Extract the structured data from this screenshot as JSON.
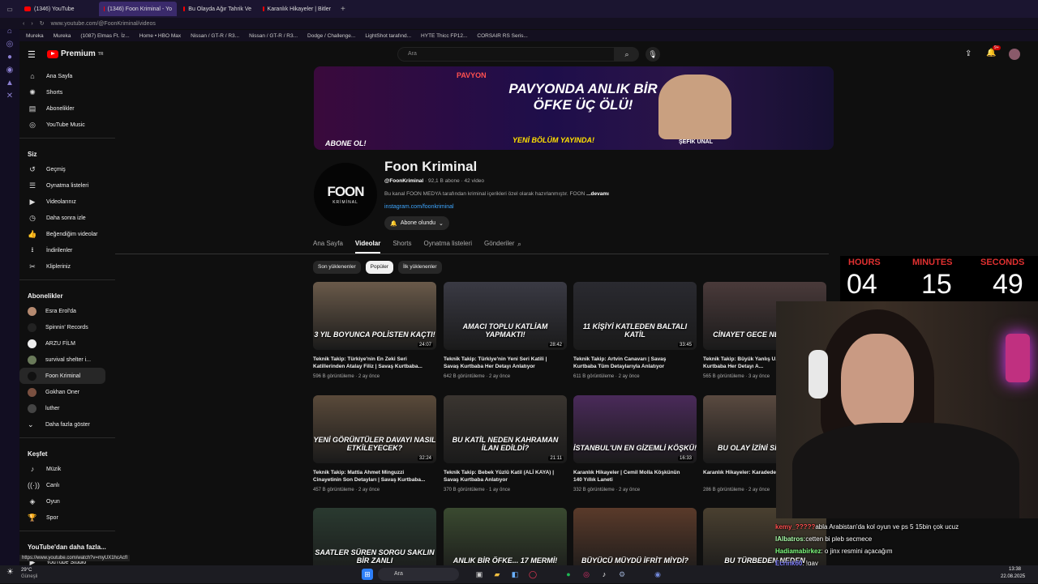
{
  "browser": {
    "tabs": [
      {
        "label": "(1346) YouTube",
        "active": false
      },
      {
        "label": "(1346) Foon Kriminal - Yo",
        "active": true
      },
      {
        "label": "Bu Olayda Ağır Tahrik Ve",
        "active": false
      },
      {
        "label": "Karanlık Hikayeler | Bitler",
        "active": false
      }
    ],
    "url": "www.youtube.com/@FoonKriminal/videos",
    "bookmarks": [
      "Mureka",
      "Mureka",
      "(1087) Elmas Ft. İz...",
      "Home • HBO Max",
      "Nissan / GT-R / R3...",
      "Nissan / GT-R / R3...",
      "Dodge / Challenge...",
      "LightShot tarafınd...",
      "HYTE Thicc FP12...",
      "CORSAIR RS Seris..."
    ],
    "status_url": "https://www.youtube.com/watch?v=myUX1hcAcfI"
  },
  "header": {
    "logo": "Premium",
    "logo_sup": "TR",
    "search_placeholder": "Ara",
    "notif_count": "9+"
  },
  "sidebar": {
    "main": [
      {
        "label": "Ana Sayfa",
        "icon": "home-icon"
      },
      {
        "label": "Shorts",
        "icon": "shorts-icon"
      },
      {
        "label": "Abonelikler",
        "icon": "subscriptions-icon"
      },
      {
        "label": "YouTube Music",
        "icon": "music-icon"
      }
    ],
    "you_title": "Siz",
    "you": [
      {
        "label": "Geçmiş"
      },
      {
        "label": "Oynatma listeleri"
      },
      {
        "label": "Videolarınız"
      },
      {
        "label": "Daha sonra izle"
      },
      {
        "label": "Beğendiğim videolar"
      },
      {
        "label": "İndirilenler"
      },
      {
        "label": "Klipleriniz"
      }
    ],
    "subs_title": "Abonelikler",
    "subs": [
      {
        "label": "Esra Erol'da",
        "color": "#b58a70"
      },
      {
        "label": "Spinnin' Records",
        "color": "#222222"
      },
      {
        "label": "ARZU FİLM",
        "color": "#eeeeee"
      },
      {
        "label": "survival shelter i...",
        "color": "#6a7a5a"
      },
      {
        "label": "Foon Kriminal",
        "color": "#111111"
      },
      {
        "label": "Gokhan Oner",
        "color": "#7a5040"
      },
      {
        "label": "luther",
        "color": "#444444"
      },
      {
        "label": "Daha fazla göster",
        "color": ""
      }
    ],
    "explore_title": "Keşfet",
    "explore": [
      {
        "label": "Müzik"
      },
      {
        "label": "Canlı"
      },
      {
        "label": "Oyun"
      },
      {
        "label": "Spor"
      }
    ],
    "more_title": "YouTube'dan daha fazla...",
    "more": [
      {
        "label": "YouTube Studio"
      }
    ]
  },
  "banner": {
    "headline": "PAVYONDA ANLIK BİR ÖFKE ÜÇ ÖLÜ!",
    "sub": "YENİ BÖLÜM YAYINDA!",
    "cta": "ABONE OL!",
    "host": "ŞEFİK ÜNAL",
    "sign": "PAVYON"
  },
  "channel": {
    "avatar_text": "FOON",
    "avatar_sub": "KRİMİNAL",
    "name": "Foon Kriminal",
    "handle": "@FoonKriminal",
    "meta": "92,1 B abone · 42 video",
    "description": "Bu kanal FOON MEDYA tarafından kriminal içerikleri özel olarak hazırlanmıştır. FOON",
    "more": "...devamı",
    "link": "instagram.com/foonkriminal",
    "subscribed_label": "Abone olundu"
  },
  "tabs": [
    "Ana Sayfa",
    "Videolar",
    "Shorts",
    "Oynatma listeleri",
    "Gönderiler"
  ],
  "active_tab": "Videolar",
  "chips": [
    "Son yüklenenler",
    "Popüler",
    "İlk yüklenenler"
  ],
  "videos": [
    {
      "caption": "3 YIL BOYUNCA POLİSTEN KAÇTI!",
      "duration": "24:07",
      "title": "Teknik Takip: Türkiye'nin En Zeki Seri Katillerinden Atalay Filiz | Savaş Kurtbaba...",
      "meta": "596 B görüntüleme · 2 ay önce",
      "bg": "#6a5a4a"
    },
    {
      "caption": "AMACI TOPLU KATLİAM YAPMAKTI!",
      "duration": "28:42",
      "title": "Teknik Takip: Türkiye'nin Yeni Seri Katili | Savaş Kurtbaba Her Detayı Anlatıyor",
      "meta": "642 B görüntüleme · 2 ay önce",
      "bg": "#3a3a44"
    },
    {
      "caption": "11 KİŞİYİ KATLEDEN BALTALI KATİL",
      "duration": "33:45",
      "title": "Teknik Takip: Artvin Canavarı | Savaş Kurtbaba Tüm Detaylarıyla Anlatıyor",
      "meta": "611 B görüntüleme · 2 ay önce",
      "bg": "#2a2a30"
    },
    {
      "caption": "CİNAYET GECE NELER OLDU",
      "duration": "",
      "title": "Teknik Takip: Büyük Yanlış U... Savaş Kurtbaba Her Detayı A...",
      "meta": "565 B görüntüleme · 3 ay önce",
      "bg": "#4a3a3a"
    },
    {
      "caption": "YENİ GÖRÜNTÜLER DAVAYI NASIL ETKİLEYECEK?",
      "duration": "32:24",
      "title": "Teknik Takip: Mattia Ahmet Minguzzi Cinayetinin Son Detayları | Savaş Kurtbaba...",
      "meta": "457 B görüntüleme · 2 ay önce",
      "bg": "#5a4a3a"
    },
    {
      "caption": "BU KATİL NEDEN KAHRAMAN İLAN EDİLDİ?",
      "duration": "21:11",
      "title": "Teknik Takip: Bebek Yüzlü Katil (ALİ KAYA) | Savaş Kurtbaba Anlatıyor",
      "meta": "370 B görüntüleme · 1 ay önce",
      "bg": "#3a3530"
    },
    {
      "caption": "İSTANBUL'UN EN GİZEMLİ KÖŞKÜ!",
      "duration": "16:33",
      "title": "Karanlık Hikayeler | Cemil Molla Köşkünün 140 Yıllık Laneti",
      "meta": "332 B görüntüleme · 2 ay önce",
      "bg": "#4a2a5a"
    },
    {
      "caption": "BU OLAY İZİNİ SİLDİ ÖLÜM",
      "duration": "",
      "title": "Karanlık Hikayeler: Karadede...",
      "meta": "286 B görüntüleme · 2 ay önce",
      "bg": "#5a4a40"
    },
    {
      "caption": "SAATLER SÜREN SORGU SAKLIN BİR ZANLI",
      "duration": "",
      "title": "",
      "meta": "",
      "bg": "#2a3a30"
    },
    {
      "caption": "ANLIK BİR ÖFKE... 17 MERMİ!",
      "duration": "",
      "title": "",
      "meta": "",
      "bg": "#3a4a30"
    },
    {
      "caption": "BÜYÜCÜ MÜYDÜ İFRİT MİYDİ?",
      "duration": "",
      "title": "",
      "meta": "",
      "bg": "#5a3a2a"
    },
    {
      "caption": "BU TÜRBEDEN NEDEN",
      "duration": "",
      "title": "",
      "meta": "",
      "bg": "#4a4030"
    }
  ],
  "timer": {
    "h_label": "HOURS",
    "m_label": "MINUTES",
    "s_label": "SECONDS",
    "h": "04",
    "m": "15",
    "s": "49"
  },
  "chat": [
    {
      "user": "kemy_?????",
      "msg": "abla Arabistan'da kol oyun ve ps 5 15bin çok ucuz",
      "color": "#ff5050"
    },
    {
      "user": "lAlbatros:",
      "msg": "cetten bi pleb secmece",
      "color": "#aaffaa"
    },
    {
      "user": "Hadiamabirkez",
      "msg": ": o jinx resmini açacağım",
      "color": "#7fff7f"
    },
    {
      "user": "Ecrink60",
      "msg": ": !gay",
      "color": "#8080ff"
    },
    {
      "user": "BotRix",
      "msg": ": @Ecrink60 senin gay olma ihtimalin: Rand[0,100]%",
      "color": "#50ff50"
    }
  ],
  "taskbar": {
    "weather_temp": "29°C",
    "weather_desc": "Güneşli",
    "search": "Ara",
    "time": "13:38",
    "date": "22.08.2025"
  }
}
